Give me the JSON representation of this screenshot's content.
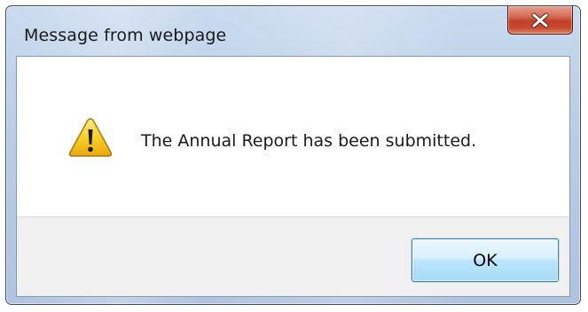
{
  "dialog": {
    "title": "Message from webpage",
    "message": "The Annual Report has been submitted.",
    "icon": "warning-icon",
    "ok_label": "OK",
    "close_icon": "close-icon"
  },
  "colors": {
    "frame": "#b9cde6",
    "close_button": "#c84a30",
    "button_area": "#f0f0f0",
    "ok_button_border": "#3c7fb1",
    "warning_fill": "#f5c518"
  }
}
